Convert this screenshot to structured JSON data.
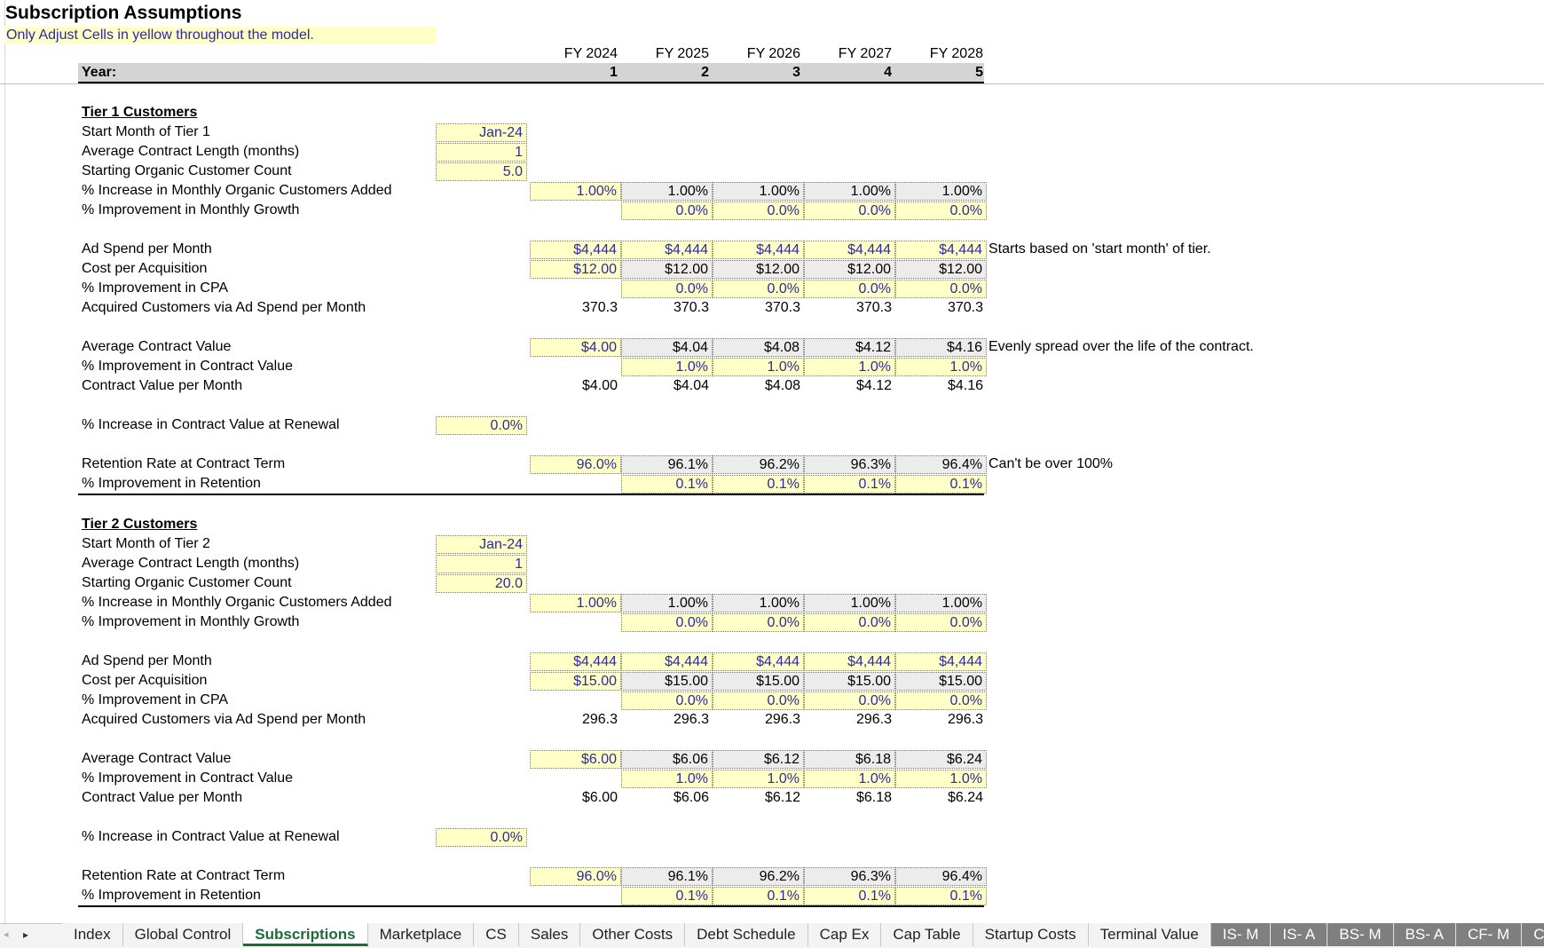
{
  "title": "Subscription Assumptions",
  "subtitle": "Only Adjust Cells in yellow throughout the model.",
  "fiscal_years": [
    "FY 2024",
    "FY 2025",
    "FY 2026",
    "FY 2027",
    "FY 2028"
  ],
  "year_label": "Year:",
  "year_numbers": [
    "1",
    "2",
    "3",
    "4",
    "5"
  ],
  "tier1": {
    "heading": "Tier 1 Customers",
    "start_month_label": "Start Month of Tier 1",
    "start_month": "Jan-24",
    "contract_length_label": "Average Contract Length (months)",
    "contract_length": "1",
    "starting_count_label": "Starting Organic Customer Count",
    "starting_count": "5.0",
    "organic_increase_label": "% Increase in Monthly Organic Customers Added",
    "organic_increase": [
      "1.00%",
      "1.00%",
      "1.00%",
      "1.00%",
      "1.00%"
    ],
    "monthly_growth_label": "% Improvement in Monthly Growth",
    "monthly_growth": [
      "0.0%",
      "0.0%",
      "0.0%",
      "0.0%"
    ],
    "ad_spend_label": "Ad Spend per Month",
    "ad_spend": [
      "$4,444",
      "$4,444",
      "$4,444",
      "$4,444",
      "$4,444"
    ],
    "ad_spend_note": "Starts based on 'start month' of tier.",
    "cpa_label": "Cost per Acquisition",
    "cpa": [
      "$12.00",
      "$12.00",
      "$12.00",
      "$12.00",
      "$12.00"
    ],
    "cpa_improve_label": "% Improvement in CPA",
    "cpa_improve": [
      "0.0%",
      "0.0%",
      "0.0%",
      "0.0%"
    ],
    "acquired_label": "Acquired Customers via Ad Spend per Month",
    "acquired": [
      "370.3",
      "370.3",
      "370.3",
      "370.3",
      "370.3"
    ],
    "acv_label": "Average Contract Value",
    "acv": [
      "$4.00",
      "$4.04",
      "$4.08",
      "$4.12",
      "$4.16"
    ],
    "acv_note": "Evenly spread over the life of the contract.",
    "acv_improve_label": "% Improvement in Contract Value",
    "acv_improve": [
      "1.0%",
      "1.0%",
      "1.0%",
      "1.0%"
    ],
    "cv_month_label": "Contract Value per Month",
    "cv_month": [
      "$4.00",
      "$4.04",
      "$4.08",
      "$4.12",
      "$4.16"
    ],
    "renewal_label": "% Increase in Contract Value at Renewal",
    "renewal": "0.0%",
    "retention_label": "Retention Rate at Contract Term",
    "retention": [
      "96.0%",
      "96.1%",
      "96.2%",
      "96.3%",
      "96.4%"
    ],
    "retention_note": "Can't be over 100%",
    "retention_improve_label": "% Improvement in Retention",
    "retention_improve": [
      "0.1%",
      "0.1%",
      "0.1%",
      "0.1%"
    ]
  },
  "tier2": {
    "heading": "Tier 2 Customers",
    "start_month_label": "Start Month of Tier 2",
    "start_month": "Jan-24",
    "contract_length_label": "Average Contract Length (months)",
    "contract_length": "1",
    "starting_count_label": "Starting Organic Customer Count",
    "starting_count": "20.0",
    "organic_increase_label": "% Increase in Monthly Organic Customers Added",
    "organic_increase": [
      "1.00%",
      "1.00%",
      "1.00%",
      "1.00%",
      "1.00%"
    ],
    "monthly_growth_label": "% Improvement in Monthly Growth",
    "monthly_growth": [
      "0.0%",
      "0.0%",
      "0.0%",
      "0.0%"
    ],
    "ad_spend_label": "Ad Spend per Month",
    "ad_spend": [
      "$4,444",
      "$4,444",
      "$4,444",
      "$4,444",
      "$4,444"
    ],
    "cpa_label": "Cost per Acquisition",
    "cpa": [
      "$15.00",
      "$15.00",
      "$15.00",
      "$15.00",
      "$15.00"
    ],
    "cpa_improve_label": "% Improvement in CPA",
    "cpa_improve": [
      "0.0%",
      "0.0%",
      "0.0%",
      "0.0%"
    ],
    "acquired_label": "Acquired Customers via Ad Spend per Month",
    "acquired": [
      "296.3",
      "296.3",
      "296.3",
      "296.3",
      "296.3"
    ],
    "acv_label": "Average Contract Value",
    "acv": [
      "$6.00",
      "$6.06",
      "$6.12",
      "$6.18",
      "$6.24"
    ],
    "acv_improve_label": "% Improvement in Contract Value",
    "acv_improve": [
      "1.0%",
      "1.0%",
      "1.0%",
      "1.0%"
    ],
    "cv_month_label": "Contract Value per Month",
    "cv_month": [
      "$6.00",
      "$6.06",
      "$6.12",
      "$6.18",
      "$6.24"
    ],
    "renewal_label": "% Increase in Contract Value at Renewal",
    "renewal": "0.0%",
    "retention_label": "Retention Rate at Contract Term",
    "retention": [
      "96.0%",
      "96.1%",
      "96.2%",
      "96.3%",
      "96.4%"
    ],
    "retention_improve_label": "% Improvement in Retention",
    "retention_improve": [
      "0.1%",
      "0.1%",
      "0.1%",
      "0.1%"
    ]
  },
  "tabs": [
    "Index",
    "Global Control",
    "Subscriptions",
    "Marketplace",
    "CS",
    "Sales",
    "Other Costs",
    "Debt Schedule",
    "Cap Ex",
    "Cap Table",
    "Startup Costs",
    "Terminal Value",
    "IS- M",
    "IS- A",
    "BS- M",
    "BS- A",
    "CF- M",
    "CF"
  ],
  "active_tab": "Subscriptions",
  "colors": {
    "input_fill": "#ffffc8",
    "input_text": "#2a2aa8",
    "active_tab": "#1e6b37",
    "header_fill": "#d4d4d4"
  }
}
